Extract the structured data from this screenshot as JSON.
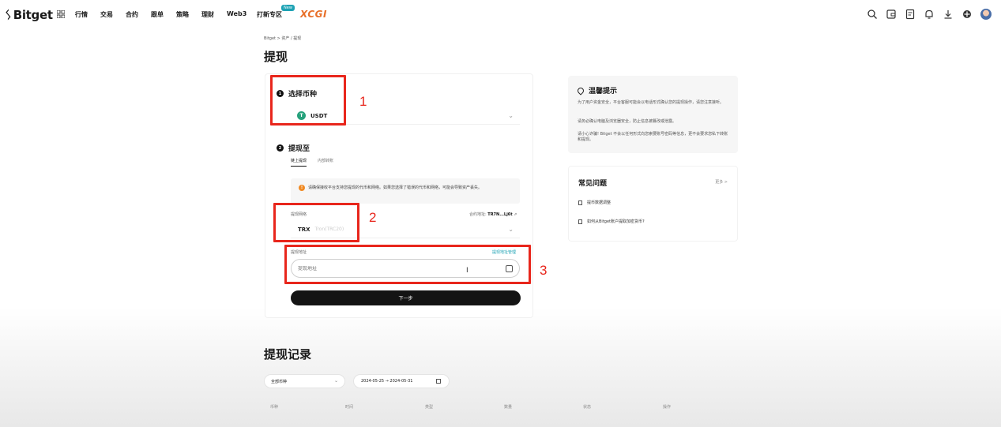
{
  "header": {
    "brand": "Bitget",
    "nav_items": [
      "行情",
      "交易",
      "合约",
      "跟单",
      "策略",
      "理财",
      "Web3",
      "打新专区"
    ],
    "new_badge": "New",
    "promo": "XCGI"
  },
  "breadcrumb": "Bitget  >  资产  /  提现",
  "page_title": "提现",
  "step1": {
    "number": "1",
    "title": "选择币种",
    "coin_symbol": "T",
    "coin": "USDT"
  },
  "step2": {
    "number": "2",
    "title": "提现至",
    "tabs": [
      "链上提现",
      "内部转账"
    ],
    "warning": "请确保接收平台支持您提现的代币和网络。如果您选择了错误的代币和网络，可能会导致资产丢失。",
    "network_label": "提现网络",
    "contract_label": "合约地址: ",
    "contract_value": "TR7N...Lj6t",
    "network": "TRX",
    "network_sub": "Tron(TRC20)",
    "address_label": "提现地址",
    "address_link": "提现地址管理",
    "address_placeholder": "提现地址",
    "next_button": "下一步"
  },
  "annotations": [
    "1",
    "2",
    "3"
  ],
  "tips": {
    "title": "温馨提示",
    "lines": [
      "为了用户资金安全，平台客服可能会以电话形式确认您的提现操作，请您注意接听。",
      "请务必确认电脑及浏览器安全，防止信息被篡改或泄露。",
      "请小心诈骗! Bitget 不会以任何形式向您索要账号密码等信息，更不会要求您私下转账和提现。"
    ]
  },
  "faq": {
    "title": "常见问题",
    "more": "更多 >",
    "items": [
      "提币数据调整",
      "如何从Bitget账户提取加密货币?"
    ]
  },
  "history": {
    "title": "提现记录",
    "coin_filter": "全部币种",
    "date_range": "2024-05-25  →  2024-05-31",
    "columns": [
      "币种",
      "时间",
      "类型",
      "数量",
      "状态",
      "操作"
    ]
  },
  "colors": {
    "accent_red": "#e8261c",
    "usdt_green": "#26a17b",
    "link_teal": "#1da2b4",
    "warning_orange": "#f08a24"
  }
}
